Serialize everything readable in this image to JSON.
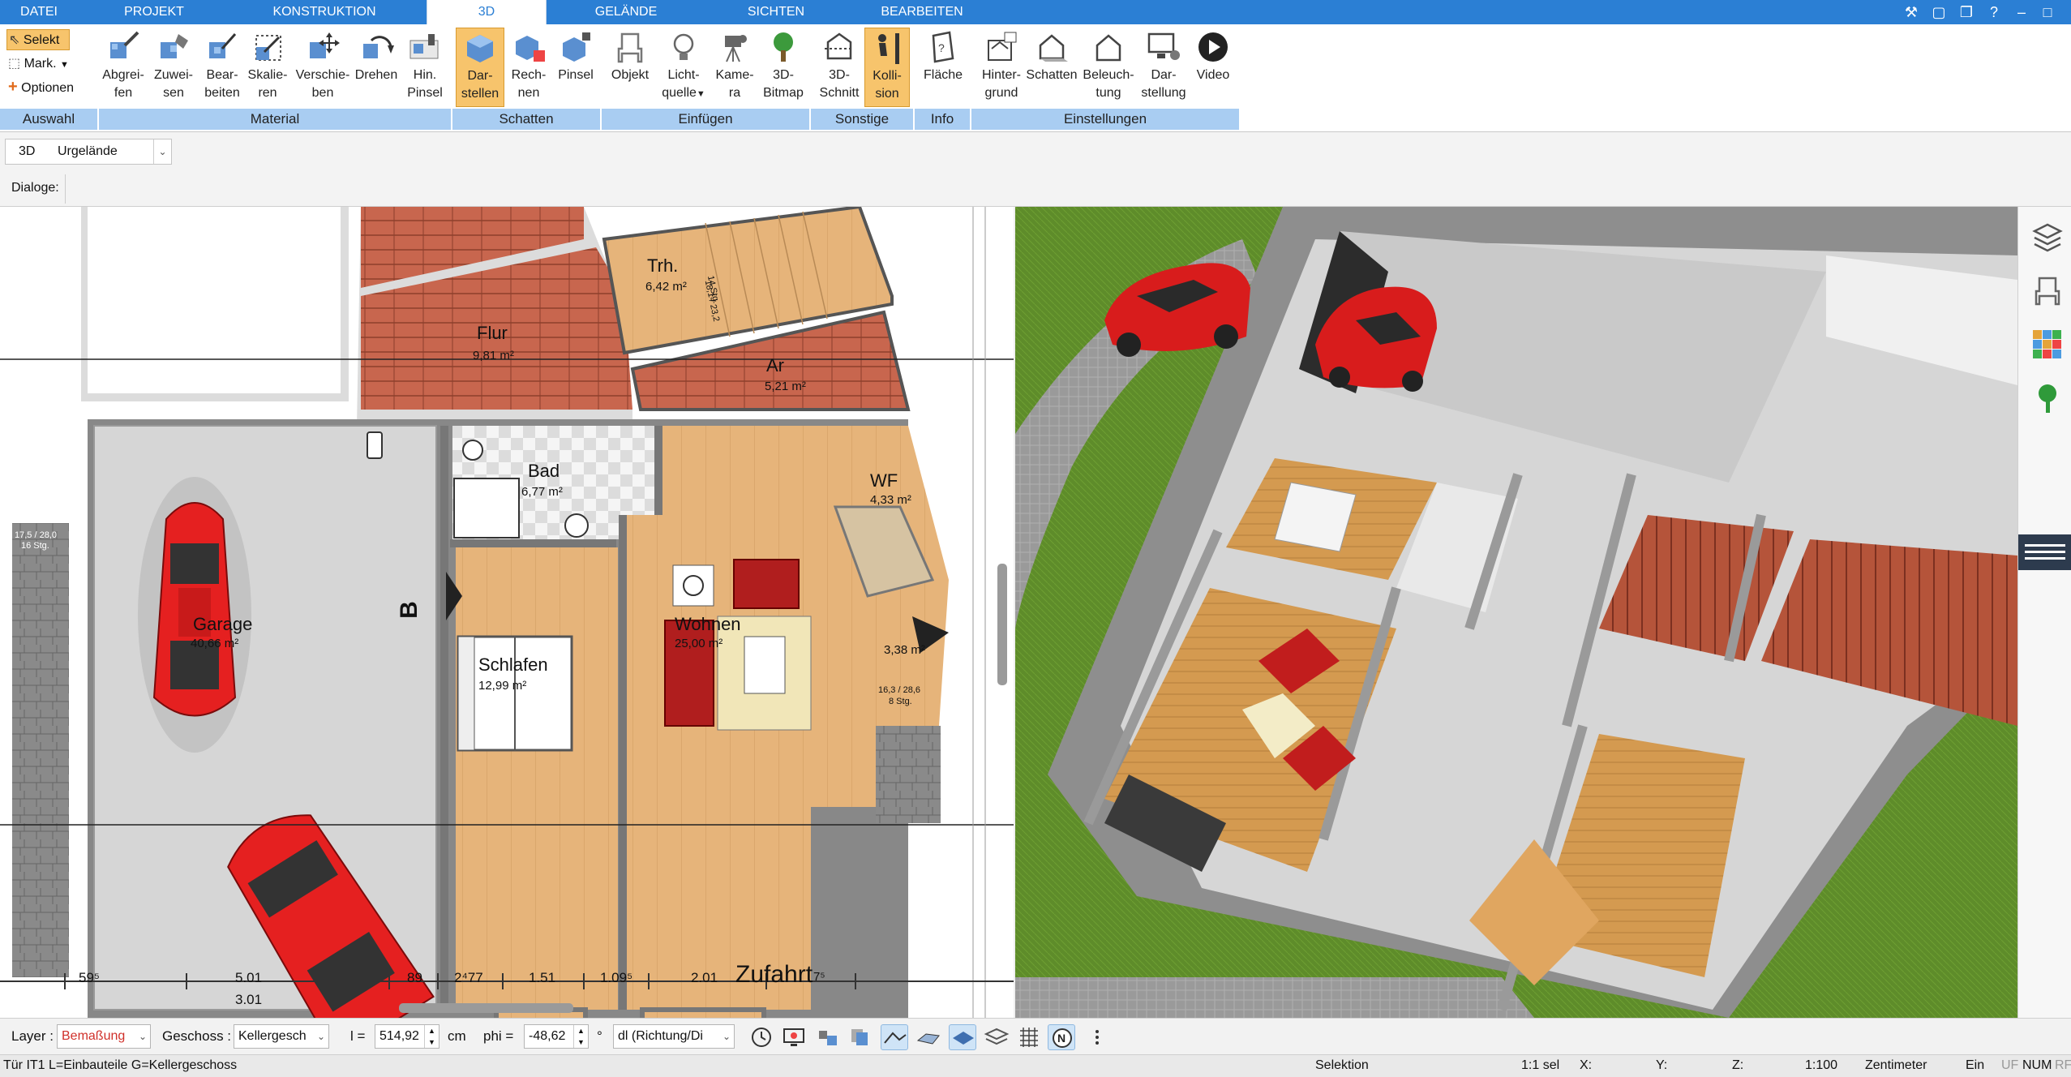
{
  "menu": {
    "tabs": [
      {
        "label": "DATEI",
        "active": false
      },
      {
        "label": "PROJEKT",
        "active": false
      },
      {
        "label": "KONSTRUKTION",
        "active": false
      },
      {
        "label": "3D",
        "active": true
      },
      {
        "label": "GELÄNDE",
        "active": false
      },
      {
        "label": "SICHTEN",
        "active": false
      },
      {
        "label": "BEARBEITEN",
        "active": false
      }
    ]
  },
  "ribbon": {
    "auswahl": {
      "selekt": "Selekt",
      "mark": "Mark.",
      "optionen": "Optionen",
      "group": "Auswahl"
    },
    "material": {
      "group": "Material",
      "buttons": [
        {
          "l1": "Abgrei-",
          "l2": "fen"
        },
        {
          "l1": "Zuwei-",
          "l2": "sen"
        },
        {
          "l1": "Bear-",
          "l2": "beiten"
        },
        {
          "l1": "Skalie-",
          "l2": "ren"
        },
        {
          "l1": "Verschie-",
          "l2": "ben"
        },
        {
          "l1": "Drehen",
          "l2": ""
        },
        {
          "l1": "Hin.",
          "l2": "Pinsel"
        }
      ]
    },
    "schatten": {
      "group": "Schatten",
      "buttons": [
        {
          "l1": "Dar-",
          "l2": "stellen"
        },
        {
          "l1": "Rech-",
          "l2": "nen"
        },
        {
          "l1": "Pinsel",
          "l2": ""
        }
      ]
    },
    "einfuegen": {
      "group": "Einfügen",
      "buttons": [
        {
          "l1": "Objekt",
          "l2": ""
        },
        {
          "l1": "Licht-",
          "l2": "quelle"
        },
        {
          "l1": "Kame-",
          "l2": "ra"
        },
        {
          "l1": "3D-",
          "l2": "Bitmap"
        }
      ]
    },
    "sonstige": {
      "group": "Sonstige",
      "buttons": [
        {
          "l1": "3D-",
          "l2": "Schnitt"
        },
        {
          "l1": "Kolli-",
          "l2": "sion"
        }
      ]
    },
    "info": {
      "group": "Info",
      "buttons": [
        {
          "l1": "Fläche",
          "l2": ""
        }
      ]
    },
    "einstellungen": {
      "group": "Einstellungen",
      "buttons": [
        {
          "l1": "Hinter-",
          "l2": "grund"
        },
        {
          "l1": "Schatten",
          "l2": ""
        },
        {
          "l1": "Beleuch-",
          "l2": "tung"
        },
        {
          "l1": "Dar-",
          "l2": "stellung"
        },
        {
          "l1": "Video",
          "l2": ""
        }
      ]
    }
  },
  "toolrow": {
    "mode": "3D",
    "terrain": "Urgelände"
  },
  "dialogs_label": "Dialoge:",
  "plan": {
    "rooms": [
      {
        "name": "Flur",
        "area": "9,81 m²"
      },
      {
        "name": "Trh.",
        "area": "6,42 m²"
      },
      {
        "name": "Ar",
        "area": "5,21 m²"
      },
      {
        "name": "Bad",
        "area": "6,77 m²"
      },
      {
        "name": "WF",
        "area": "4,33 m²"
      },
      {
        "name": "Garage",
        "area": "40,66 m²"
      },
      {
        "name": "Wohnen",
        "area": "25,00 m²"
      },
      {
        "name": "Schlafen",
        "area": "12,99 m²"
      },
      {
        "name": "",
        "area": "3,38 m²"
      }
    ],
    "stair_labels": [
      "17,5 / 28,0",
      "16 Stg.",
      "16,3 / 28,6",
      "8 Stg.",
      "18,1 / 23,2",
      "14 Stg."
    ],
    "section_marker": "B",
    "street": "Zufahrt",
    "dims": [
      "59⁵",
      "5.01",
      "89",
      "2⁴77",
      "1.51",
      "1.09⁵",
      "2.01",
      "7⁵",
      "3.01"
    ]
  },
  "bottombar": {
    "layer_label": "Layer :",
    "layer_value": "Bemaßung",
    "geschoss_label": "Geschoss :",
    "geschoss_value": "Kellergesch",
    "l_label": "l =",
    "l_value": "514,92",
    "l_unit": "cm",
    "phi_label": "phi =",
    "phi_value": "-48,62",
    "phi_unit": "°",
    "dir_value": "dl (Richtung/Di"
  },
  "statusbar": {
    "left": "Tür IT1 L=Einbauteile G=Kellergeschoss",
    "mode": "Selektion",
    "scale_sel": "1:1 sel",
    "x": "X:",
    "y": "Y:",
    "z": "Z:",
    "scale": "1:100",
    "unit": "Zentimeter",
    "ein": "Ein",
    "flags": [
      "UF",
      "NUM",
      "RF"
    ]
  },
  "colors": {
    "accent": "#2b7fd4",
    "ribbon_group": "#a9cdf2",
    "active_button": "#f7c46c",
    "layer_value": "#d0302a"
  }
}
